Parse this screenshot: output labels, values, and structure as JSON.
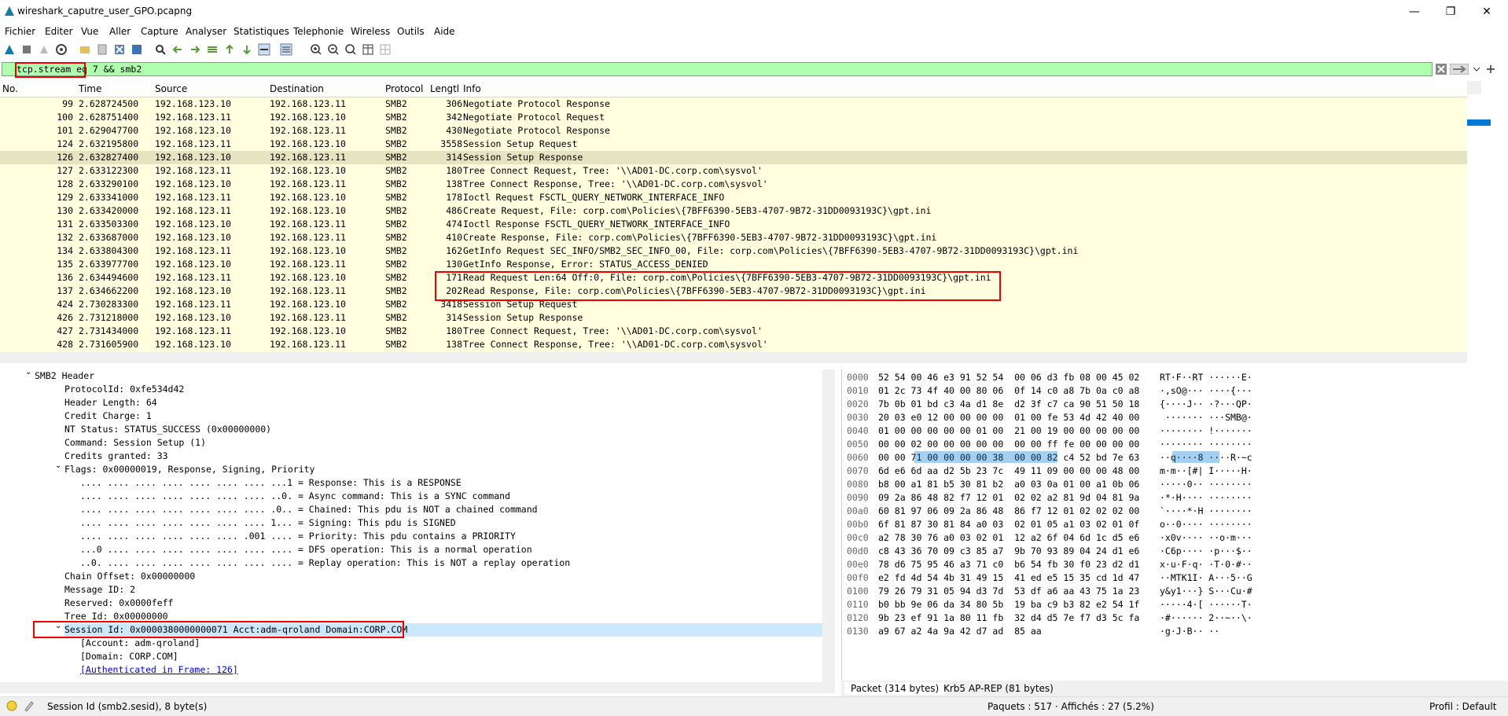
{
  "window": {
    "title": "wireshark_caputre_user_GPO.pcapng",
    "minimize": "—",
    "maximize": "❐",
    "close": "✕"
  },
  "menu": [
    "Fichier",
    "Editer",
    "Vue",
    "Aller",
    "Capture",
    "Analyser",
    "Statistiques",
    "Telephonie",
    "Wireless",
    "Outils",
    "Aide"
  ],
  "filter": {
    "value": "tcp.stream eq 7 && smb2"
  },
  "columns": [
    "No.",
    "Time",
    "Source",
    "Destination",
    "Protocol",
    "Lengtl",
    "Info"
  ],
  "packets": [
    {
      "no": "99",
      "time": "2.628724500",
      "src": "192.168.123.10",
      "dst": "192.168.123.11",
      "proto": "SMB2",
      "len": "306",
      "info": "Negotiate Protocol Response"
    },
    {
      "no": "100",
      "time": "2.628751400",
      "src": "192.168.123.11",
      "dst": "192.168.123.10",
      "proto": "SMB2",
      "len": "342",
      "info": "Negotiate Protocol Request"
    },
    {
      "no": "101",
      "time": "2.629047700",
      "src": "192.168.123.10",
      "dst": "192.168.123.11",
      "proto": "SMB2",
      "len": "430",
      "info": "Negotiate Protocol Response"
    },
    {
      "no": "124",
      "time": "2.632195800",
      "src": "192.168.123.11",
      "dst": "192.168.123.10",
      "proto": "SMB2",
      "len": "3558",
      "info": "Session Setup Request"
    },
    {
      "no": "126",
      "time": "2.632827400",
      "src": "192.168.123.10",
      "dst": "192.168.123.11",
      "proto": "SMB2",
      "len": "314",
      "info": "Session Setup Response"
    },
    {
      "no": "127",
      "time": "2.633122300",
      "src": "192.168.123.11",
      "dst": "192.168.123.10",
      "proto": "SMB2",
      "len": "180",
      "info": "Tree Connect Request, Tree: '\\\\AD01-DC.corp.com\\sysvol'"
    },
    {
      "no": "128",
      "time": "2.633290100",
      "src": "192.168.123.10",
      "dst": "192.168.123.11",
      "proto": "SMB2",
      "len": "138",
      "info": "Tree Connect Response, Tree: '\\\\AD01-DC.corp.com\\sysvol'"
    },
    {
      "no": "129",
      "time": "2.633341000",
      "src": "192.168.123.11",
      "dst": "192.168.123.10",
      "proto": "SMB2",
      "len": "178",
      "info": "Ioctl Request FSCTL_QUERY_NETWORK_INTERFACE_INFO"
    },
    {
      "no": "130",
      "time": "2.633420000",
      "src": "192.168.123.11",
      "dst": "192.168.123.10",
      "proto": "SMB2",
      "len": "486",
      "info": "Create Request, File: corp.com\\Policies\\{7BFF6390-5EB3-4707-9B72-31DD0093193C}\\gpt.ini"
    },
    {
      "no": "131",
      "time": "2.633503300",
      "src": "192.168.123.10",
      "dst": "192.168.123.11",
      "proto": "SMB2",
      "len": "474",
      "info": "Ioctl Response FSCTL_QUERY_NETWORK_INTERFACE_INFO"
    },
    {
      "no": "132",
      "time": "2.633687000",
      "src": "192.168.123.10",
      "dst": "192.168.123.11",
      "proto": "SMB2",
      "len": "410",
      "info": "Create Response, File: corp.com\\Policies\\{7BFF6390-5EB3-4707-9B72-31DD0093193C}\\gpt.ini"
    },
    {
      "no": "134",
      "time": "2.633804300",
      "src": "192.168.123.11",
      "dst": "192.168.123.10",
      "proto": "SMB2",
      "len": "162",
      "info": "GetInfo Request SEC_INFO/SMB2_SEC_INFO_00, File: corp.com\\Policies\\{7BFF6390-5EB3-4707-9B72-31DD0093193C}\\gpt.ini"
    },
    {
      "no": "135",
      "time": "2.633977700",
      "src": "192.168.123.10",
      "dst": "192.168.123.11",
      "proto": "SMB2",
      "len": "130",
      "info": "GetInfo Response, Error: STATUS_ACCESS_DENIED"
    },
    {
      "no": "136",
      "time": "2.634494600",
      "src": "192.168.123.11",
      "dst": "192.168.123.10",
      "proto": "SMB2",
      "len": "171",
      "info": "Read Request Len:64 Off:0, File: corp.com\\Policies\\{7BFF6390-5EB3-4707-9B72-31DD0093193C}\\gpt.ini"
    },
    {
      "no": "137",
      "time": "2.634662200",
      "src": "192.168.123.10",
      "dst": "192.168.123.11",
      "proto": "SMB2",
      "len": "202",
      "info": "Read Response, File: corp.com\\Policies\\{7BFF6390-5EB3-4707-9B72-31DD0093193C}\\gpt.ini"
    },
    {
      "no": "424",
      "time": "2.730283300",
      "src": "192.168.123.11",
      "dst": "192.168.123.10",
      "proto": "SMB2",
      "len": "3418",
      "info": "Session Setup Request"
    },
    {
      "no": "426",
      "time": "2.731218000",
      "src": "192.168.123.10",
      "dst": "192.168.123.11",
      "proto": "SMB2",
      "len": "314",
      "info": "Session Setup Response"
    },
    {
      "no": "427",
      "time": "2.731434000",
      "src": "192.168.123.11",
      "dst": "192.168.123.10",
      "proto": "SMB2",
      "len": "180",
      "info": "Tree Connect Request, Tree: '\\\\AD01-DC.corp.com\\sysvol'"
    },
    {
      "no": "428",
      "time": "2.731605900",
      "src": "192.168.123.10",
      "dst": "192.168.123.11",
      "proto": "SMB2",
      "len": "138",
      "info": "Tree Connect Response, Tree: '\\\\AD01-DC.corp.com\\sysvol'"
    }
  ],
  "selected_packet": "126",
  "details": [
    {
      "indent": 1,
      "arrow": "expanded",
      "text": "SMB2 Header"
    },
    {
      "indent": 2,
      "text": "ProtocolId: 0xfe534d42"
    },
    {
      "indent": 2,
      "text": "Header Length: 64"
    },
    {
      "indent": 2,
      "text": "Credit Charge: 1"
    },
    {
      "indent": 2,
      "text": "NT Status: STATUS_SUCCESS (0x00000000)"
    },
    {
      "indent": 2,
      "text": "Command: Session Setup (1)"
    },
    {
      "indent": 2,
      "text": "Credits granted: 33"
    },
    {
      "indent": 2,
      "arrow": "expanded",
      "text": "Flags: 0x00000019, Response, Signing, Priority"
    },
    {
      "indent": 3,
      "text": ".... .... .... .... .... .... .... ...1 = Response: This is a RESPONSE"
    },
    {
      "indent": 3,
      "text": ".... .... .... .... .... .... .... ..0. = Async command: This is a SYNC command"
    },
    {
      "indent": 3,
      "text": ".... .... .... .... .... .... .... .0.. = Chained: This pdu is NOT a chained command"
    },
    {
      "indent": 3,
      "text": ".... .... .... .... .... .... .... 1... = Signing: This pdu is SIGNED"
    },
    {
      "indent": 3,
      "text": ".... .... .... .... .... .... .001 .... = Priority: This pdu contains a PRIORITY"
    },
    {
      "indent": 3,
      "text": "...0 .... .... .... .... .... .... .... = DFS operation: This is a normal operation"
    },
    {
      "indent": 3,
      "text": "..0. .... .... .... .... .... .... .... = Replay operation: This is NOT a replay operation"
    },
    {
      "indent": 2,
      "text": "Chain Offset: 0x00000000"
    },
    {
      "indent": 2,
      "text": "Message ID: 2"
    },
    {
      "indent": 2,
      "text": "Reserved: 0x0000feff"
    },
    {
      "indent": 2,
      "text": "Tree Id: 0x00000000"
    },
    {
      "indent": 2,
      "arrow": "expanded",
      "text": "Session Id: 0x0000380000000071 Acct:adm-qroland Domain:CORP.COM",
      "selected": true
    },
    {
      "indent": 3,
      "text": "[Account: adm-qroland]"
    },
    {
      "indent": 3,
      "text": "[Domain: CORP.COM]"
    },
    {
      "indent": 3,
      "text": "[Authenticated in Frame: 126]",
      "link": true
    }
  ],
  "hex": [
    {
      "off": "0000",
      "hex": "52 54 00 46 e3 91 52 54  00 06 d3 fb 08 00 45 02",
      "ascii": "RT·F··RT ······E·"
    },
    {
      "off": "0010",
      "hex": "01 2c 73 4f 40 00 80 06  0f 14 c0 a8 7b 0a c0 a8",
      "ascii": "·,sO@··· ····{···"
    },
    {
      "off": "0020",
      "hex": "7b 0b 01 bd c3 4a d1 8e  d2 3f c7 ca 90 51 50 18",
      "ascii": "{····J·· ·?···QP·"
    },
    {
      "off": "0030",
      "hex": "20 03 e0 12 00 00 00 00  01 00 fe 53 4d 42 40 00",
      "ascii": " ······· ···SMB@·"
    },
    {
      "off": "0040",
      "hex": "01 00 00 00 00 00 01 00  21 00 19 00 00 00 00 00",
      "ascii": "········ !·······"
    },
    {
      "off": "0050",
      "hex": "00 00 02 00 00 00 00 00  00 00 ff fe 00 00 00 00",
      "ascii": "········ ········"
    },
    {
      "off": "0060",
      "hex": "00 00 71 00 00 00 00 38  00 00 82 c4 52 bd 7e 63",
      "ascii": "··q····8 ····R·~c"
    },
    {
      "off": "0070",
      "hex": "6d e6 6d aa d2 5b 23 7c  49 11 09 00 00 00 48 00",
      "ascii": "m·m··[#| I·····H·"
    },
    {
      "off": "0080",
      "hex": "b8 00 a1 81 b5 30 81 b2  a0 03 0a 01 00 a1 0b 06",
      "ascii": "·····0·· ········"
    },
    {
      "off": "0090",
      "hex": "09 2a 86 48 82 f7 12 01  02 02 a2 81 9d 04 81 9a",
      "ascii": "·*·H···· ········"
    },
    {
      "off": "00a0",
      "hex": "60 81 97 06 09 2a 86 48  86 f7 12 01 02 02 02 00",
      "ascii": "`····*·H ········"
    },
    {
      "off": "00b0",
      "hex": "6f 81 87 30 81 84 a0 03  02 01 05 a1 03 02 01 0f",
      "ascii": "o··0···· ········"
    },
    {
      "off": "00c0",
      "hex": "a2 78 30 76 a0 03 02 01  12 a2 6f 04 6d 1c d5 e6",
      "ascii": "·x0v···· ··o·m···"
    },
    {
      "off": "00d0",
      "hex": "c8 43 36 70 09 c3 85 a7  9b 70 93 89 04 24 d1 e6",
      "ascii": "·C6p···· ·p···$··"
    },
    {
      "off": "00e0",
      "hex": "78 d6 75 95 46 a3 71 c0  b6 54 fb 30 f0 23 d2 d1",
      "ascii": "x·u·F·q· ·T·0·#··"
    },
    {
      "off": "00f0",
      "hex": "e2 fd 4d 54 4b 31 49 15  41 ed e5 15 35 cd 1d 47",
      "ascii": "··MTK1I· A···5··G"
    },
    {
      "off": "0100",
      "hex": "79 26 79 31 05 94 d3 7d  53 df a6 aa 43 75 1a 23",
      "ascii": "y&y1···} S···Cu·#"
    },
    {
      "off": "0110",
      "hex": "b0 bb 9e 06 da 34 80 5b  19 ba c9 b3 82 e2 54 1f",
      "ascii": "·····4·[ ······T·"
    },
    {
      "off": "0120",
      "hex": "9b 23 ef 91 1a 80 11 fb  32 d4 d5 7e f7 d3 5c fa",
      "ascii": "·#······ 2··~··\\·"
    },
    {
      "off": "0130",
      "hex": "a9 67 a2 4a 9a 42 d7 ad  85 aa",
      "ascii": "·g·J·B·· ··"
    }
  ],
  "byte_tabs": [
    "Packet (314 bytes)",
    "Krb5 AP-REP (81 bytes)"
  ],
  "status": {
    "field": "Session Id (smb2.sesid), 8 byte(s)",
    "packets": "Paquets : 517 · Affichés : 27 (5.2%)",
    "profile": "Profil : Default"
  },
  "colors": {
    "row_bg": "#ffffe0",
    "row_selected": "#e4e4c0",
    "filter_bg": "#afffaf",
    "highlight": "#0078d7",
    "annotation": "#ee0000"
  }
}
